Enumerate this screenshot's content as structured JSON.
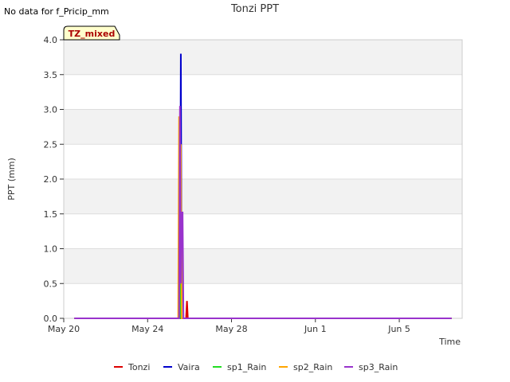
{
  "notice": "No data for f_Pricip_mm",
  "badge": "TZ_mixed",
  "chart_data": {
    "type": "line",
    "title": "Tonzi PPT",
    "xlabel": "Time",
    "ylabel": "PPT (mm)",
    "ylim": [
      0,
      4.0
    ],
    "xlim": [
      "2024-05-20",
      "2024-06-08"
    ],
    "yticks": [
      "0.0",
      "0.5",
      "1.0",
      "1.5",
      "2.0",
      "2.5",
      "3.0",
      "3.5",
      "4.0"
    ],
    "xticks": [
      {
        "label": "May 20",
        "date": "2024-05-20"
      },
      {
        "label": "May 24",
        "date": "2024-05-24"
      },
      {
        "label": "May 28",
        "date": "2024-05-28"
      },
      {
        "label": "Jun 1",
        "date": "2024-06-01"
      },
      {
        "label": "Jun 5",
        "date": "2024-06-05"
      }
    ],
    "grid": true,
    "legend_position": "bottom",
    "series": [
      {
        "name": "Tonzi",
        "color": "#dd0000",
        "points": [
          [
            "2024-05-20 12:00",
            0
          ],
          [
            "2024-05-25 20:00",
            0
          ],
          [
            "2024-05-25 21:00",
            0.25
          ],
          [
            "2024-05-25 22:00",
            0
          ],
          [
            "2024-06-07 12:00",
            0
          ]
        ]
      },
      {
        "name": "Vaira",
        "color": "#0000cc",
        "points": [
          [
            "2024-05-20 12:00",
            0
          ],
          [
            "2024-05-25 13:00",
            0
          ],
          [
            "2024-05-25 14:00",
            3.8
          ],
          [
            "2024-05-25 15:00",
            0
          ],
          [
            "2024-06-07 12:00",
            0
          ]
        ]
      },
      {
        "name": "sp1_Rain",
        "color": "#22dd22",
        "points": [
          [
            "2024-05-20 12:00",
            0
          ],
          [
            "2024-05-25 13:00",
            0
          ],
          [
            "2024-05-25 14:00",
            1.8
          ],
          [
            "2024-05-25 15:00",
            0
          ],
          [
            "2024-06-07 12:00",
            0
          ]
        ]
      },
      {
        "name": "sp2_Rain",
        "color": "#ffa500",
        "points": [
          [
            "2024-05-20 12:00",
            0
          ],
          [
            "2024-05-25 11:00",
            0
          ],
          [
            "2024-05-25 12:00",
            2.9
          ],
          [
            "2024-05-25 13:00",
            0.5
          ],
          [
            "2024-05-25 14:00",
            2.5
          ],
          [
            "2024-05-25 15:00",
            0
          ],
          [
            "2024-06-07 12:00",
            0
          ]
        ]
      },
      {
        "name": "sp3_Rain",
        "color": "#9933cc",
        "points": [
          [
            "2024-05-20 12:00",
            0
          ],
          [
            "2024-05-25 12:00",
            0
          ],
          [
            "2024-05-25 13:00",
            3.05
          ],
          [
            "2024-05-25 14:00",
            0.5
          ],
          [
            "2024-05-25 15:00",
            1.52
          ],
          [
            "2024-05-25 16:00",
            1.52
          ],
          [
            "2024-05-25 17:00",
            0
          ],
          [
            "2024-06-07 12:00",
            0
          ]
        ]
      }
    ]
  }
}
